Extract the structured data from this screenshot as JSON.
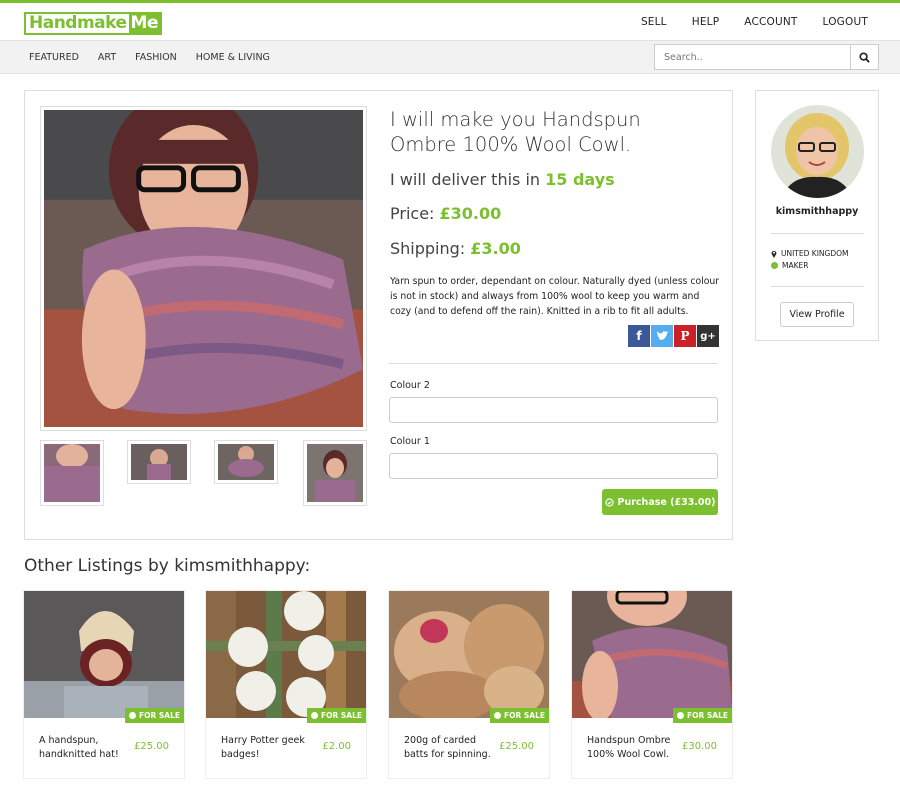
{
  "header": {
    "logo_part1": "Handmake",
    "logo_part2": "Me",
    "nav": [
      "SELL",
      "HELP",
      "ACCOUNT",
      "LOGOUT"
    ]
  },
  "categories": [
    "FEATURED",
    "ART",
    "FASHION",
    "HOME & LIVING"
  ],
  "search": {
    "placeholder": "Search.."
  },
  "listing": {
    "title": "I will make you Handspun Ombre 100% Wool Cowl.",
    "deliver_prefix": "I will deliver this in ",
    "deliver_days": "15 days",
    "price_label": "Price: ",
    "price_value": "£30.00",
    "shipping_label": "Shipping: ",
    "shipping_value": "£3.00",
    "description": "Yarn spun to order, dependant on colour. Naturally dyed (unless colour is not in stock) and always from 100% wool to keep you warm and cozy (and to defend off the rain). Knitted in a rib to fit all adults.",
    "social_icons": [
      "facebook-icon",
      "twitter-icon",
      "pinterest-icon",
      "googleplus-icon"
    ],
    "option1_label": "Colour 2",
    "option2_label": "Colour 1",
    "option1_value": "",
    "option2_value": "",
    "purchase_label": "Purchase (£33.00)"
  },
  "seller": {
    "username": "kimsmithhappy",
    "location": "UNITED KINGDOM",
    "role": "MAKER",
    "view_profile": "View Profile"
  },
  "other": {
    "heading": "Other Listings by kimsmithhappy:",
    "items": [
      {
        "title": "A handspun, handknitted hat!",
        "price": "£25.00",
        "badge": "FOR SALE"
      },
      {
        "title": "Harry Potter geek badges!",
        "price": "£2.00",
        "badge": "FOR SALE"
      },
      {
        "title": "200g of carded batts for spinning.",
        "price": "£25.00",
        "badge": "FOR SALE"
      },
      {
        "title": "Handspun Ombre 100% Wool Cowl.",
        "price": "£30.00",
        "badge": "FOR SALE"
      }
    ]
  },
  "colors": {
    "accent": "#7cc030"
  }
}
